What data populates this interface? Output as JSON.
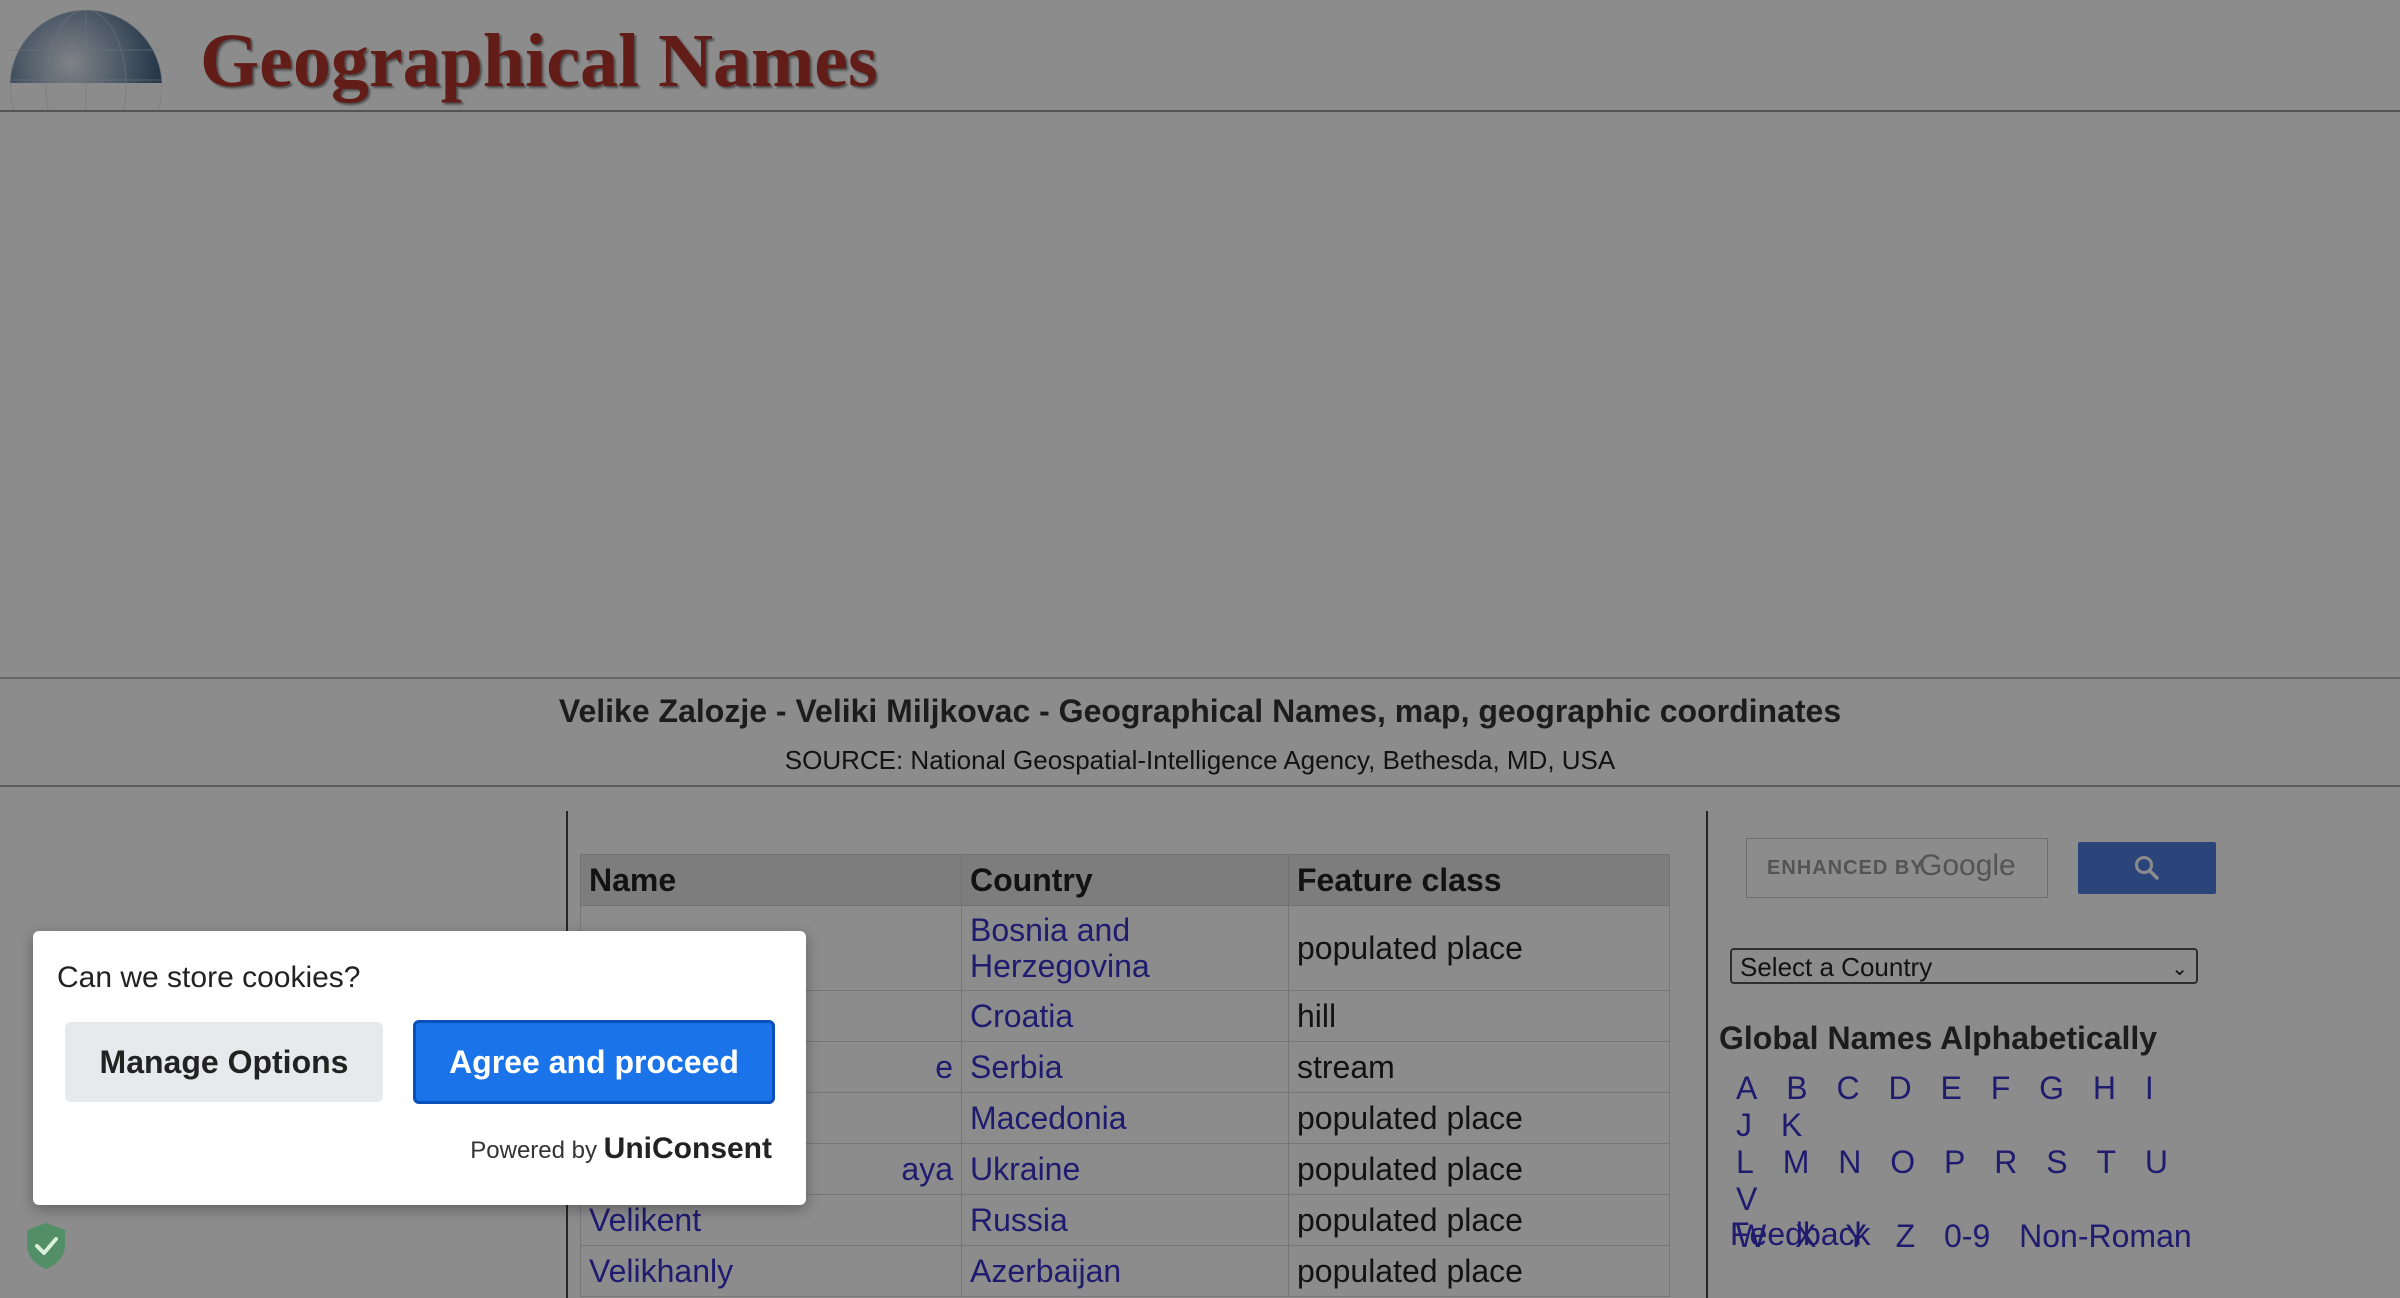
{
  "header": {
    "site_title": "Geographical Names"
  },
  "page": {
    "heading": "Velike Zalozje - Veliki Miljkovac - Geographical Names, map, geographic coordinates",
    "source": "SOURCE: National Geospatial-Intelligence Agency, Bethesda, MD, USA"
  },
  "table": {
    "headers": [
      "Name",
      "Country",
      "Feature class"
    ],
    "rows": [
      {
        "name": "",
        "country": "Bosnia and Herzegovina",
        "feature": "populated place"
      },
      {
        "name": "",
        "country": "Croatia",
        "feature": "hill"
      },
      {
        "name": "e",
        "country": "Serbia",
        "feature": "stream"
      },
      {
        "name": "",
        "country": "Macedonia",
        "feature": "populated place"
      },
      {
        "name": "aya",
        "country": "Ukraine",
        "feature": "populated place"
      },
      {
        "name": "Velikent",
        "country": "Russia",
        "feature": "populated place"
      },
      {
        "name": "Velikhanly",
        "country": "Azerbaijan",
        "feature": "populated place"
      }
    ]
  },
  "sidebar": {
    "search_placeholder": "ENHANCED BY",
    "search_brand": "Google",
    "search_icon": "search-icon",
    "country_select": "Select a Country",
    "alpha_heading": "Global Names Alphabetically",
    "letters": [
      "A",
      "B",
      "C",
      "D",
      "E",
      "F",
      "G",
      "H",
      "I",
      "J",
      "K",
      "L",
      "M",
      "N",
      "O",
      "P",
      "R",
      "S",
      "T",
      "U",
      "V",
      "W",
      "X",
      "Y",
      "Z",
      "0-9",
      "Non-Roman"
    ],
    "feedback": "Feedback"
  },
  "consent": {
    "question": "Can we store cookies?",
    "manage_label": "Manage Options",
    "agree_label": "Agree and proceed",
    "powered_prefix": "Powered by",
    "powered_brand": "UniConsent"
  },
  "colors": {
    "link": "#3a32c8",
    "title_red": "#b3362c",
    "agree_blue": "#1a73e8",
    "overlay": "rgba(0,0,0,0.45)"
  }
}
